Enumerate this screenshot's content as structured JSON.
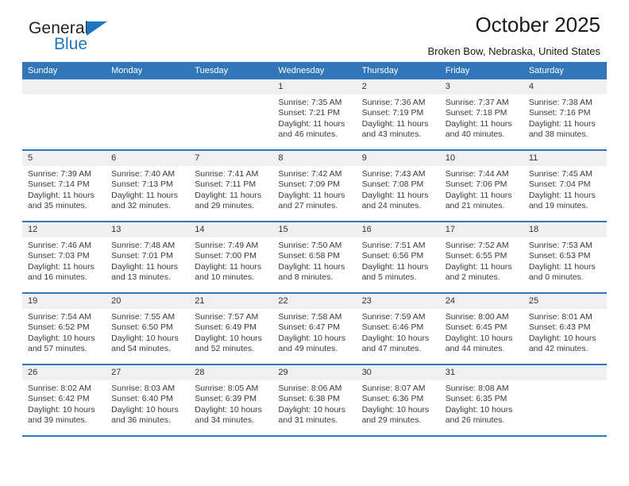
{
  "brand": {
    "line1": "General",
    "line2": "Blue",
    "triangle_icon": "triangle-icon",
    "colors": {
      "dark": "#231f20",
      "blue": "#1d76bd"
    }
  },
  "header": {
    "title": "October 2025",
    "subtitle": "Broken Bow, Nebraska, United States"
  },
  "theme": {
    "header_blue": "#3275b8",
    "daynum_gray": "#f0f0f0",
    "text": "#3a3a3a"
  },
  "weekday_headers": [
    "Sunday",
    "Monday",
    "Tuesday",
    "Wednesday",
    "Thursday",
    "Friday",
    "Saturday"
  ],
  "labels": {
    "sunrise": "Sunrise:",
    "sunset": "Sunset:",
    "daylight": "Daylight:"
  },
  "weeks": [
    [
      {
        "day": "",
        "empty": true
      },
      {
        "day": "",
        "empty": true
      },
      {
        "day": "",
        "empty": true
      },
      {
        "day": "1",
        "sunrise": "Sunrise: 7:35 AM",
        "sunset": "Sunset: 7:21 PM",
        "daylight_l1": "Daylight: 11 hours",
        "daylight_l2": "and 46 minutes."
      },
      {
        "day": "2",
        "sunrise": "Sunrise: 7:36 AM",
        "sunset": "Sunset: 7:19 PM",
        "daylight_l1": "Daylight: 11 hours",
        "daylight_l2": "and 43 minutes."
      },
      {
        "day": "3",
        "sunrise": "Sunrise: 7:37 AM",
        "sunset": "Sunset: 7:18 PM",
        "daylight_l1": "Daylight: 11 hours",
        "daylight_l2": "and 40 minutes."
      },
      {
        "day": "4",
        "sunrise": "Sunrise: 7:38 AM",
        "sunset": "Sunset: 7:16 PM",
        "daylight_l1": "Daylight: 11 hours",
        "daylight_l2": "and 38 minutes."
      }
    ],
    [
      {
        "day": "5",
        "sunrise": "Sunrise: 7:39 AM",
        "sunset": "Sunset: 7:14 PM",
        "daylight_l1": "Daylight: 11 hours",
        "daylight_l2": "and 35 minutes."
      },
      {
        "day": "6",
        "sunrise": "Sunrise: 7:40 AM",
        "sunset": "Sunset: 7:13 PM",
        "daylight_l1": "Daylight: 11 hours",
        "daylight_l2": "and 32 minutes."
      },
      {
        "day": "7",
        "sunrise": "Sunrise: 7:41 AM",
        "sunset": "Sunset: 7:11 PM",
        "daylight_l1": "Daylight: 11 hours",
        "daylight_l2": "and 29 minutes."
      },
      {
        "day": "8",
        "sunrise": "Sunrise: 7:42 AM",
        "sunset": "Sunset: 7:09 PM",
        "daylight_l1": "Daylight: 11 hours",
        "daylight_l2": "and 27 minutes."
      },
      {
        "day": "9",
        "sunrise": "Sunrise: 7:43 AM",
        "sunset": "Sunset: 7:08 PM",
        "daylight_l1": "Daylight: 11 hours",
        "daylight_l2": "and 24 minutes."
      },
      {
        "day": "10",
        "sunrise": "Sunrise: 7:44 AM",
        "sunset": "Sunset: 7:06 PM",
        "daylight_l1": "Daylight: 11 hours",
        "daylight_l2": "and 21 minutes."
      },
      {
        "day": "11",
        "sunrise": "Sunrise: 7:45 AM",
        "sunset": "Sunset: 7:04 PM",
        "daylight_l1": "Daylight: 11 hours",
        "daylight_l2": "and 19 minutes."
      }
    ],
    [
      {
        "day": "12",
        "sunrise": "Sunrise: 7:46 AM",
        "sunset": "Sunset: 7:03 PM",
        "daylight_l1": "Daylight: 11 hours",
        "daylight_l2": "and 16 minutes."
      },
      {
        "day": "13",
        "sunrise": "Sunrise: 7:48 AM",
        "sunset": "Sunset: 7:01 PM",
        "daylight_l1": "Daylight: 11 hours",
        "daylight_l2": "and 13 minutes."
      },
      {
        "day": "14",
        "sunrise": "Sunrise: 7:49 AM",
        "sunset": "Sunset: 7:00 PM",
        "daylight_l1": "Daylight: 11 hours",
        "daylight_l2": "and 10 minutes."
      },
      {
        "day": "15",
        "sunrise": "Sunrise: 7:50 AM",
        "sunset": "Sunset: 6:58 PM",
        "daylight_l1": "Daylight: 11 hours",
        "daylight_l2": "and 8 minutes."
      },
      {
        "day": "16",
        "sunrise": "Sunrise: 7:51 AM",
        "sunset": "Sunset: 6:56 PM",
        "daylight_l1": "Daylight: 11 hours",
        "daylight_l2": "and 5 minutes."
      },
      {
        "day": "17",
        "sunrise": "Sunrise: 7:52 AM",
        "sunset": "Sunset: 6:55 PM",
        "daylight_l1": "Daylight: 11 hours",
        "daylight_l2": "and 2 minutes."
      },
      {
        "day": "18",
        "sunrise": "Sunrise: 7:53 AM",
        "sunset": "Sunset: 6:53 PM",
        "daylight_l1": "Daylight: 11 hours",
        "daylight_l2": "and 0 minutes."
      }
    ],
    [
      {
        "day": "19",
        "sunrise": "Sunrise: 7:54 AM",
        "sunset": "Sunset: 6:52 PM",
        "daylight_l1": "Daylight: 10 hours",
        "daylight_l2": "and 57 minutes."
      },
      {
        "day": "20",
        "sunrise": "Sunrise: 7:55 AM",
        "sunset": "Sunset: 6:50 PM",
        "daylight_l1": "Daylight: 10 hours",
        "daylight_l2": "and 54 minutes."
      },
      {
        "day": "21",
        "sunrise": "Sunrise: 7:57 AM",
        "sunset": "Sunset: 6:49 PM",
        "daylight_l1": "Daylight: 10 hours",
        "daylight_l2": "and 52 minutes."
      },
      {
        "day": "22",
        "sunrise": "Sunrise: 7:58 AM",
        "sunset": "Sunset: 6:47 PM",
        "daylight_l1": "Daylight: 10 hours",
        "daylight_l2": "and 49 minutes."
      },
      {
        "day": "23",
        "sunrise": "Sunrise: 7:59 AM",
        "sunset": "Sunset: 6:46 PM",
        "daylight_l1": "Daylight: 10 hours",
        "daylight_l2": "and 47 minutes."
      },
      {
        "day": "24",
        "sunrise": "Sunrise: 8:00 AM",
        "sunset": "Sunset: 6:45 PM",
        "daylight_l1": "Daylight: 10 hours",
        "daylight_l2": "and 44 minutes."
      },
      {
        "day": "25",
        "sunrise": "Sunrise: 8:01 AM",
        "sunset": "Sunset: 6:43 PM",
        "daylight_l1": "Daylight: 10 hours",
        "daylight_l2": "and 42 minutes."
      }
    ],
    [
      {
        "day": "26",
        "sunrise": "Sunrise: 8:02 AM",
        "sunset": "Sunset: 6:42 PM",
        "daylight_l1": "Daylight: 10 hours",
        "daylight_l2": "and 39 minutes."
      },
      {
        "day": "27",
        "sunrise": "Sunrise: 8:03 AM",
        "sunset": "Sunset: 6:40 PM",
        "daylight_l1": "Daylight: 10 hours",
        "daylight_l2": "and 36 minutes."
      },
      {
        "day": "28",
        "sunrise": "Sunrise: 8:05 AM",
        "sunset": "Sunset: 6:39 PM",
        "daylight_l1": "Daylight: 10 hours",
        "daylight_l2": "and 34 minutes."
      },
      {
        "day": "29",
        "sunrise": "Sunrise: 8:06 AM",
        "sunset": "Sunset: 6:38 PM",
        "daylight_l1": "Daylight: 10 hours",
        "daylight_l2": "and 31 minutes."
      },
      {
        "day": "30",
        "sunrise": "Sunrise: 8:07 AM",
        "sunset": "Sunset: 6:36 PM",
        "daylight_l1": "Daylight: 10 hours",
        "daylight_l2": "and 29 minutes."
      },
      {
        "day": "31",
        "sunrise": "Sunrise: 8:08 AM",
        "sunset": "Sunset: 6:35 PM",
        "daylight_l1": "Daylight: 10 hours",
        "daylight_l2": "and 26 minutes."
      },
      {
        "day": "",
        "empty": true
      }
    ]
  ]
}
